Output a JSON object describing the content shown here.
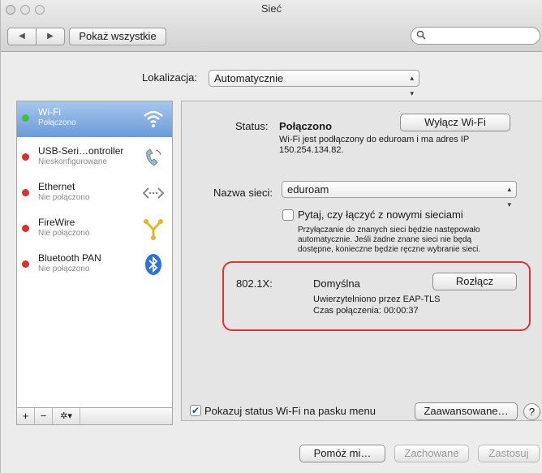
{
  "window": {
    "title": "Sieć"
  },
  "toolbar": {
    "back_label": "◀",
    "forward_label": "▶",
    "show_all_label": "Pokaż wszystkie",
    "search_placeholder": ""
  },
  "location": {
    "label": "Lokalizacja:",
    "value": "Automatycznie"
  },
  "services": [
    {
      "name": "Wi-Fi",
      "status": "Połączono",
      "dot_color": "#3fbf3f",
      "icon": "wifi-icon"
    },
    {
      "name": "USB-Seri…ontroller",
      "status": "Nieskonfigurowane",
      "dot_color": "#d93030",
      "icon": "phone-icon"
    },
    {
      "name": "Ethernet",
      "status": "Nie połączono",
      "dot_color": "#d93030",
      "icon": "ethernet-icon"
    },
    {
      "name": "FireWire",
      "status": "Nie połączono",
      "dot_color": "#d93030",
      "icon": "firewire-icon"
    },
    {
      "name": "Bluetooth PAN",
      "status": "Nie połączono",
      "dot_color": "#d93030",
      "icon": "bluetooth-icon"
    }
  ],
  "sidebar_controls": {
    "add": "+",
    "remove": "−",
    "action": "✲▾"
  },
  "panel": {
    "status_label": "Status:",
    "status_value": "Połączono",
    "turn_off_button": "Wyłącz Wi-Fi",
    "status_detail_1": "Wi-Fi jest podłączony do eduroam i ma adres IP",
    "status_detail_2": "150.254.134.82.",
    "network_name_label": "Nazwa sieci:",
    "network_name_value": "eduroam",
    "ask_join_label": "Pytaj, czy łączyć z nowymi sieciami",
    "ask_join_detail_1": "Przyłączanie do znanych sieci będzie następowało",
    "ask_join_detail_2": "automatycznie. Jeśli żadne znane sieci nie będą",
    "ask_join_detail_3": "dostępne, konieczne będzie ręczne wybranie sieci.",
    "dot1x_label": "802.1X:",
    "dot1x_profile": "Domyślna",
    "disconnect_button": "Rozłącz",
    "auth_detail": "Uwierzytelniono przez EAP-TLS",
    "connection_time": "Czas połączenia: 00:00:37",
    "show_status_label": "Pokazuj status Wi-Fi na pasku menu",
    "show_status_checked": "✔",
    "advanced_button": "Zaawansowane…",
    "help_button": "?"
  },
  "footer": {
    "assist_button": "Pomóż mi…",
    "revert_button": "Zachowane",
    "apply_button": "Zastosuj"
  },
  "colors": {
    "highlight_box": "#e23333",
    "selection": "#6c9bd8"
  }
}
